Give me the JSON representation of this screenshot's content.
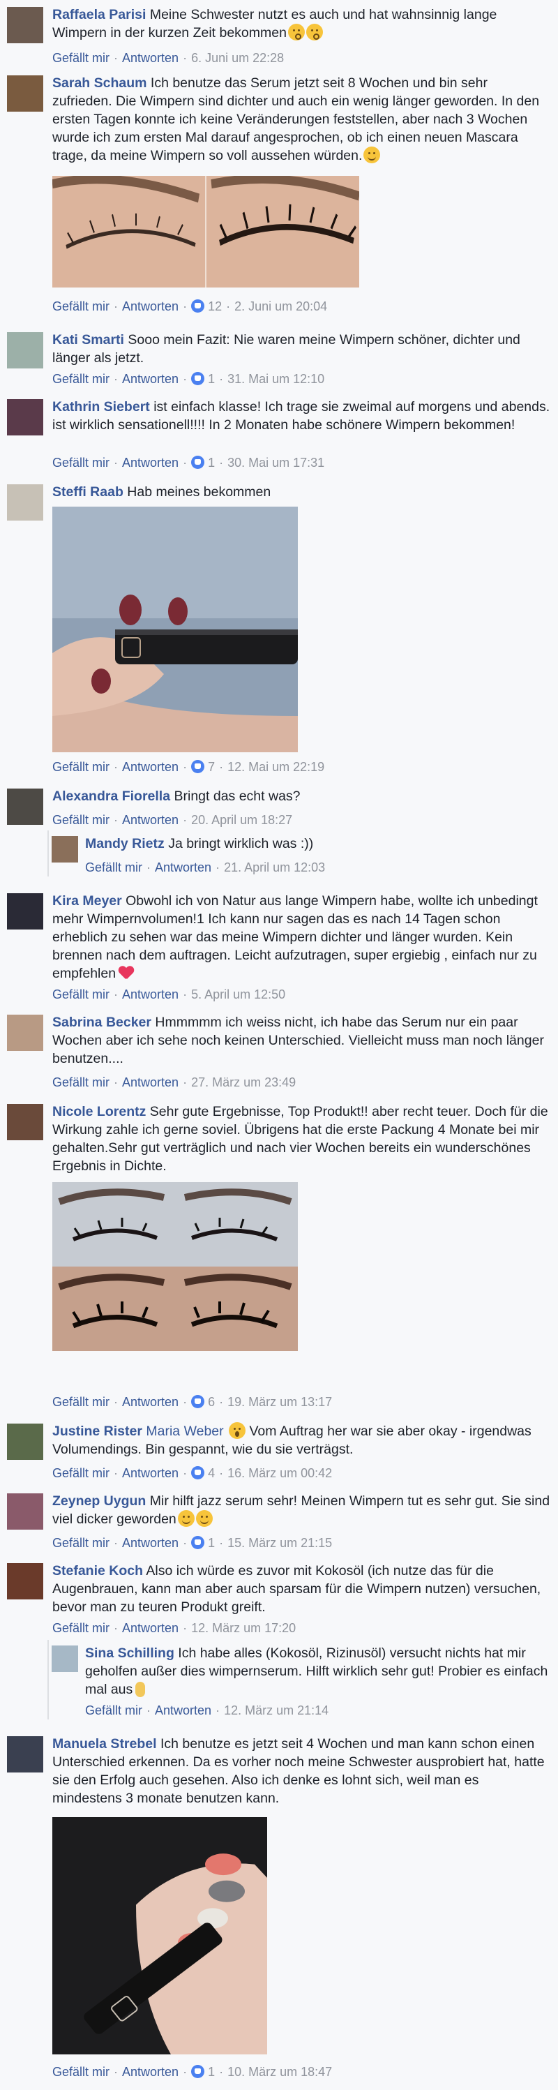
{
  "footer_labels": {
    "like": "Gefällt mir",
    "reply": "Antworten",
    "separator": "·"
  },
  "comments": [
    {
      "name": "Raffaela Parisi",
      "text": "Meine Schwester nutzt es auch und hat wahnsinnig lange Wimpern in der kurzen Zeit bekommen",
      "emoji": [
        "kissing-face-icon",
        "kissing-face-icon"
      ],
      "likes": "",
      "time": "6. Juni um 22:28"
    },
    {
      "name": "Sarah Schaum",
      "text": "Ich benutze das Serum jetzt seit 8 Wochen und bin sehr zufrieden. Die Wimpern sind dichter und auch ein wenig länger geworden. In den ersten Tagen konnte ich keine Veränderungen feststellen, aber nach 3 Wochen wurde ich zum ersten Mal darauf angesprochen, ob ich einen neuen Mascara trage, da meine Wimpern so voll aussehen würden.",
      "emoji": [
        "smiling-face-icon"
      ],
      "likes": "12",
      "time": "2. Juni um 20:04"
    },
    {
      "name": "Kati Smarti",
      "text": "Sooo mein Fazit: Nie waren meine Wimpern schöner, dichter und länger als jetzt.",
      "likes": "1",
      "time": "31. Mai um 12:10"
    },
    {
      "name": "Kathrin Siebert",
      "text": "ist einfach klasse! Ich trage sie zweimal auf morgens und abends. ist wirklich sensationell!!!! In 2 Monaten habe schönere Wimpern bekommen!",
      "likes": "1",
      "time": "30. Mai um 17:31"
    },
    {
      "name": "Steffi Raab",
      "text": "Hab meines bekommen",
      "likes": "7",
      "time": "12. Mai um 22:19"
    },
    {
      "name": "Alexandra Fiorella",
      "text": "Bringt das echt was?",
      "likes": "",
      "time": "20. April um 18:27"
    },
    {
      "name": "Mandy Rietz",
      "text": "Ja bringt wirklich was :))",
      "likes": "",
      "time": "21. April um 12:03"
    },
    {
      "name": "Kira Meyer",
      "text": "Obwohl ich von Natur aus lange Wimpern habe, wollte ich unbedingt mehr Wimpernvolumen!1 Ich kann nur sagen das es nach 14 Tagen schon erheblich zu sehen war das meine Wimpern dichter und länger wurden. Kein brennen nach dem auftragen. Leicht aufzutragen, super ergiebig , einfach nur zu empfehlen",
      "emoji": [
        "heart-icon"
      ],
      "likes": "",
      "time": "5. April um 12:50"
    },
    {
      "name": "Sabrina Becker",
      "text": "Hmmmmm ich weiss nicht, ich habe das Serum nur ein paar Wochen aber ich sehe noch keinen Unterschied. Vielleicht muss man noch länger benutzen....",
      "likes": "",
      "time": "27. März um 23:49"
    },
    {
      "name": "Nicole Lorentz",
      "text": "Sehr gute Ergebnisse, Top Produkt!! aber recht teuer. Doch für die Wirkung zahle ich gerne soviel. Übrigens hat die erste Packung 4 Monate bei mir gehalten.Sehr gut verträglich und nach vier Wochen bereits ein wunderschönes Ergebnis in Dichte.",
      "likes": "6",
      "time": "19. März um 13:17"
    },
    {
      "name": "Justine Rister",
      "tag": "Maria Weber",
      "text": "Vom Auftrag her war sie aber okay - irgendwas Volumendings. Bin gespannt, wie du sie verträgst.",
      "emoji": [
        "surprised-face-icon"
      ],
      "likes": "4",
      "time": "16. März um 00:42"
    },
    {
      "name": "Zeynep Uygun",
      "text": "Mir hilft jazz serum sehr! Meinen Wimpern tut es sehr gut. Sie sind viel dicker geworden",
      "emoji": [
        "smiling-face-icon",
        "smiling-face-icon"
      ],
      "likes": "1",
      "time": "15. März um 21:15"
    },
    {
      "name": "Stefanie Koch",
      "text": "Also ich würde es zuvor mit Kokosöl (ich nutze das für die Augenbrauen, kann man aber auch sparsam für die Wimpern nutzen) versuchen, bevor man zu teuren Produkt greift.",
      "likes": "",
      "time": "12. März um 17:20"
    },
    {
      "name": "Sina Schilling",
      "text": "Ich habe alles (Kokosöl, Rizinusöl) versucht nichts hat mir geholfen außer dies wimpernserum. Hilft wirklich sehr gut! Probier es einfach mal aus",
      "emoji": [
        "pointing-hand-icon"
      ],
      "likes": "",
      "time": "12. März um 21:14"
    },
    {
      "name": "Manuela Strebel",
      "text": "Ich benutze es jetzt seit 4 Wochen und man kann schon einen Unterschied erkennen. Da es vorher noch meine Schwester ausprobiert hat, hatte sie den Erfolg auch gesehen. Also ich denke es lohnt sich, weil man es mindestens 3 monate benutzen kann.",
      "likes": "1",
      "time": "10. März um 18:47"
    }
  ],
  "colors": {
    "link": "#385898",
    "meta": "#90949c",
    "background": "#f7f8fa",
    "like_badge": "#4a80f0"
  }
}
